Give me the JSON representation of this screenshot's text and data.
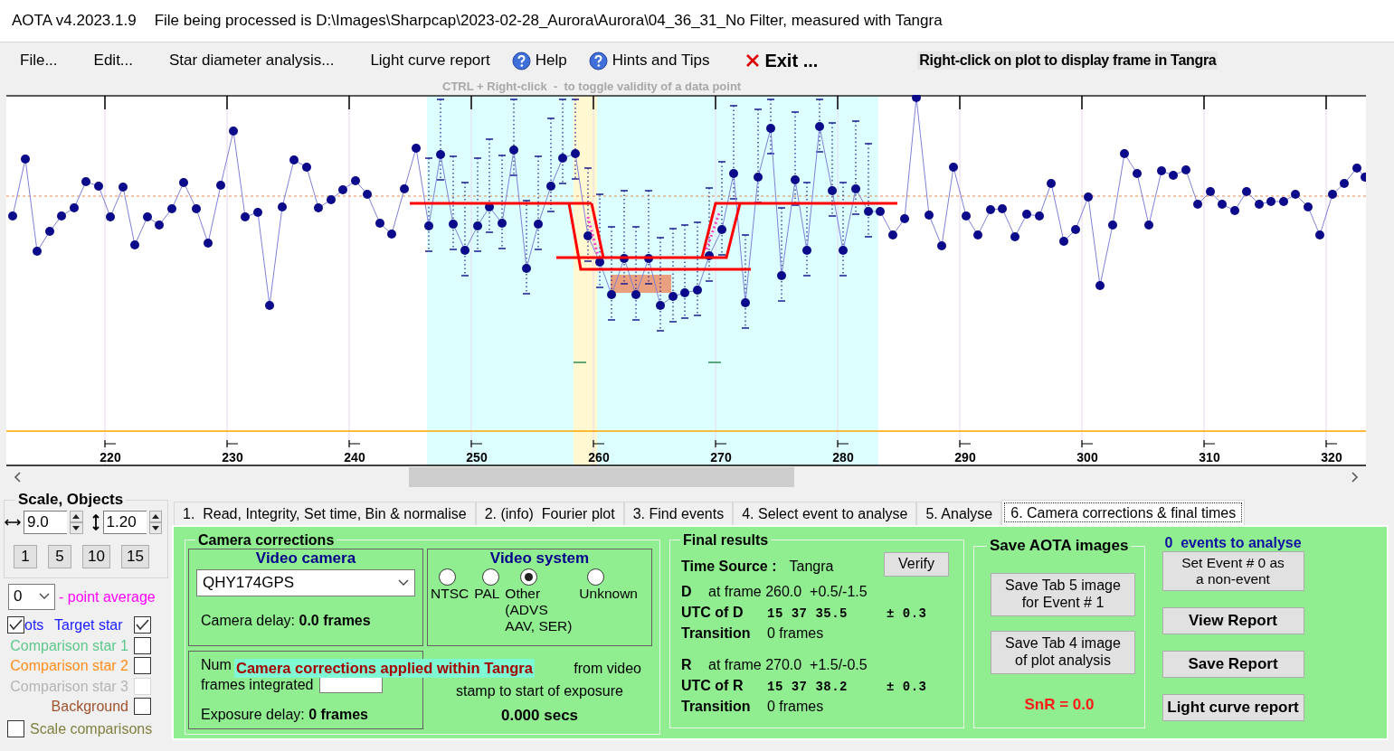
{
  "window": {
    "title": "AOTA v4.2023.1.9",
    "file_info": "File being processed is D:\\Images\\Sharpcap\\2023-02-28_Aurora\\Aurora\\04_36_31_No Filter, measured with Tangra"
  },
  "menu": [
    {
      "label": "File...",
      "kind": "plain"
    },
    {
      "label": "Edit...",
      "kind": "plain"
    },
    {
      "label": "Star diameter analysis...",
      "kind": "plain"
    },
    {
      "label": "Light curve report",
      "kind": "plain"
    },
    {
      "label": "Help",
      "kind": "help"
    },
    {
      "label": "Hints and Tips",
      "kind": "help"
    },
    {
      "label": "Exit ...",
      "kind": "exit"
    }
  ],
  "plot_hint": "Right-click on plot to display frame in Tangra",
  "toggle_hint": "CTRL + Right-click  -  to toggle validity of a data point",
  "plot": {
    "x_tick_labels": [
      "220",
      "230",
      "240",
      "250",
      "260",
      "270",
      "280",
      "290",
      "300",
      "310",
      "320"
    ]
  },
  "scale_objects": {
    "title": "Scale,  Objects",
    "x_scale": "9.0",
    "y_scale": "1.20",
    "zoom_buttons": [
      "1",
      "5",
      "10",
      "15"
    ],
    "point_average": "0",
    "point_average_label": "- point average",
    "dots": {
      "label": "ots",
      "checked": true
    },
    "objects": [
      {
        "label": "Target star",
        "color": "#1a1aff",
        "checked": true,
        "disabled": false
      },
      {
        "label": "Comparison star 1",
        "color": "#5cc88c",
        "checked": false,
        "disabled": false
      },
      {
        "label": "Comparison star 2",
        "color": "#ff8c1a",
        "checked": false,
        "disabled": false
      },
      {
        "label": "Comparison star 3",
        "color": "#b4b4b4",
        "checked": false,
        "disabled": true
      },
      {
        "label": "Background",
        "color": "#a0522d",
        "checked": false,
        "disabled": false
      }
    ],
    "scale_comparisons": {
      "label": "Scale comparisons",
      "checked": false
    }
  },
  "tabs": [
    {
      "label": "1.  Read, Integrity, Set time, Bin & normalise",
      "selected": false
    },
    {
      "label": "2. (info)  Fourier plot",
      "selected": false
    },
    {
      "label": "3. Find events",
      "selected": false
    },
    {
      "label": "4. Select event to analyse",
      "selected": false
    },
    {
      "label": "5. Analyse",
      "selected": false
    },
    {
      "label": "6. Camera corrections & final times",
      "selected": true
    }
  ],
  "camera_corrections": {
    "title": "Camera corrections",
    "video_camera": {
      "title": "Video camera",
      "value": "QHY174GPS",
      "delay": "Camera delay: **0.0 frames**"
    },
    "video_system": {
      "title": "Video system",
      "options": [
        {
          "label": "NTSC",
          "selected": false
        },
        {
          "label": "PAL",
          "selected": false
        },
        {
          "label": "Other (ADVS AAV, SER)",
          "selected": true
        },
        {
          "label": "Unknown",
          "selected": false
        }
      ]
    },
    "frames_integrated": {
      "label_start": "Num",
      "label_end": "frames integrated",
      "exposure_delay": "Exposure delay: **0 frames**"
    },
    "offset": {
      "line_1": "from video",
      "line_2": "stamp to start of exposure",
      "value": "0.000 secs"
    },
    "tangra_notice": "Camera corrections applied within Tangra"
  },
  "final_results": {
    "title": "Final results",
    "verify": "Verify",
    "time_source_label": "Time Source :",
    "time_source": "Tangra",
    "events": [
      {
        "letter": "D",
        "frame": "at frame 260.0  +0.5/-1.5",
        "utc_label": "UTC of D",
        "utc": "15 37 35.5",
        "uncertainty": "± 0.3",
        "transition_label": "Transition",
        "transition": "0 frames"
      },
      {
        "letter": "R",
        "frame": "at frame 270.0  +1.5/-0.5",
        "utc_label": "UTC of R",
        "utc": "15 37 38.2",
        "uncertainty": "± 0.3",
        "transition_label": "Transition",
        "transition": "0 frames"
      }
    ]
  },
  "save_images": {
    "title": "Save AOTA images",
    "buttons": [
      "Save Tab 5 image for Event # 1",
      "Save Tab 4 image of plot analysis"
    ],
    "snr": "SnR = 0.0"
  },
  "event_actions": {
    "count_text": "0  events to analyse",
    "buttons": [
      {
        "label": "Set Event # 0 as a non-event",
        "kind": "normal"
      },
      {
        "label": "View Report",
        "kind": "bold"
      },
      {
        "label": "Save Report",
        "kind": "bold"
      },
      {
        "label": "Light curve report",
        "kind": "bold"
      }
    ]
  }
}
